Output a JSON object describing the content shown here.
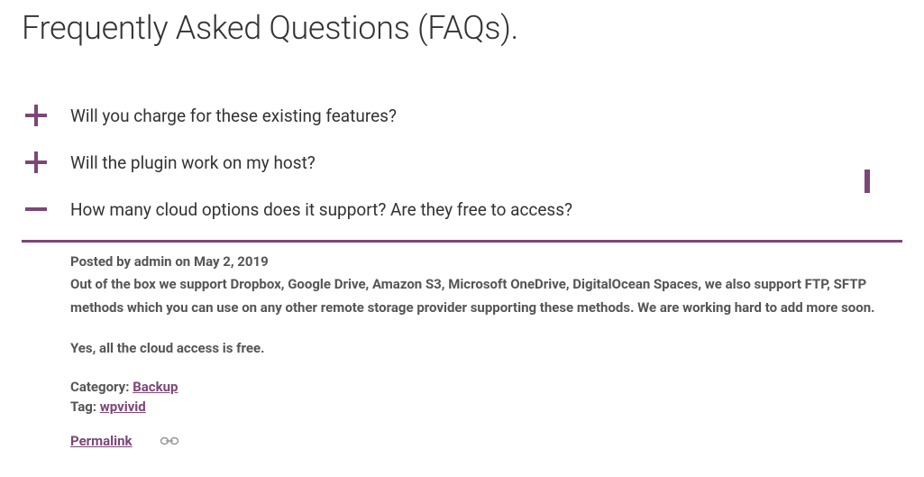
{
  "title": "Frequently Asked Questions (FAQs).",
  "accent_color": "#7c4777",
  "faq": [
    {
      "question": "Will you charge for these existing features?",
      "expanded": false
    },
    {
      "question": "Will the plugin work on my host?",
      "expanded": false
    },
    {
      "question": "How many cloud options does it support? Are they free to access?",
      "expanded": true,
      "posted_by_label": "Posted by",
      "author": "admin",
      "on_label": "on",
      "date": "May 2, 2019",
      "answer_p1": "Out of the box we support Dropbox, Google Drive, Amazon S3, Microsoft OneDrive, DigitalOcean Spaces, we also support FTP, SFTP methods which you can use on any other remote storage provider supporting these methods. We are working hard to add more soon.",
      "answer_p2": "Yes, all the cloud access is free.",
      "category_label": "Category:",
      "category_value": "Backup",
      "tag_label": "Tag:",
      "tag_value": "wpvivid",
      "permalink_label": "Permalink"
    }
  ]
}
